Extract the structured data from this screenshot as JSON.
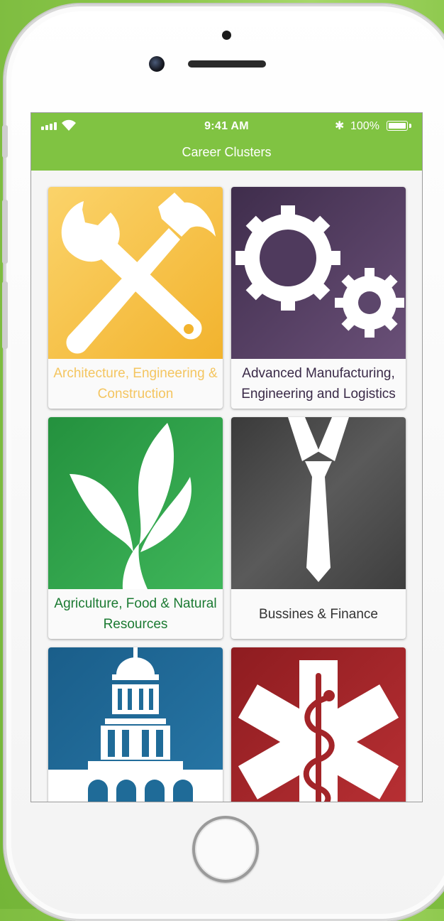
{
  "status_bar": {
    "time": "9:41 AM",
    "battery_percent": "100%",
    "bluetooth_glyph": "✱"
  },
  "header": {
    "title": "Career Clusters"
  },
  "clusters": [
    {
      "label": "Architecture, Engineering & Construction",
      "icon": "wrench-hammer-icon",
      "color": "#f6bd3a",
      "label_color": "#f4c560"
    },
    {
      "label": "Advanced Manufacturing, Engineering and Logistics",
      "icon": "gears-icon",
      "color": "#4f3a5d",
      "label_color": "#3a2a48"
    },
    {
      "label": "Agriculture, Food & Natural Resources",
      "icon": "plant-icon",
      "color": "#2e9e48",
      "label_color": "#1b7a32"
    },
    {
      "label": "Bussines & Finance",
      "icon": "necktie-icon",
      "color": "#4a4a4a",
      "label_color": "#333333"
    },
    {
      "label": "",
      "icon": "capitol-building-icon",
      "color": "#1f6b98",
      "label_color": "#1f6b98"
    },
    {
      "label": "",
      "icon": "medical-star-icon",
      "color": "#a32428",
      "label_color": "#a32428"
    }
  ],
  "colors": {
    "background": "#8cc74b",
    "bar": "#80c342"
  }
}
